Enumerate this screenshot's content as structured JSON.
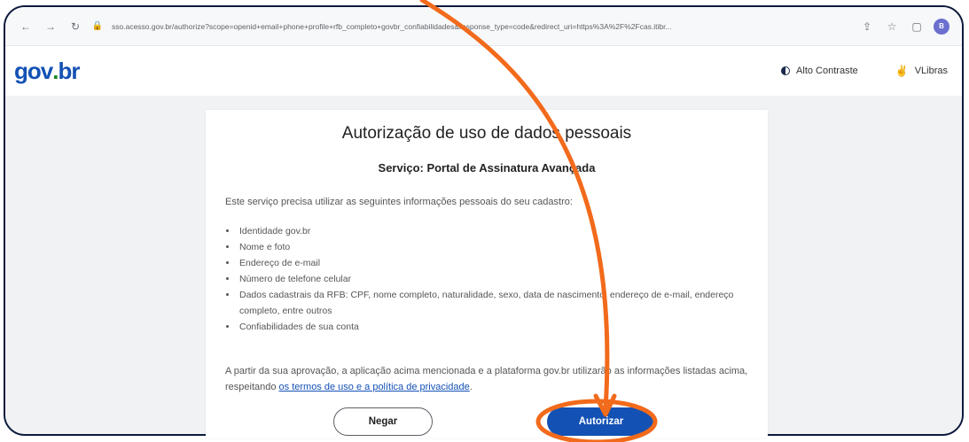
{
  "browser": {
    "url": "sso.acesso.gov.br/authorize?scope=openid+email+phone+profile+rfb_completo+govbr_confiabilidades&response_type=code&redirect_uri=https%3A%2F%2Fcas.itibr..."
  },
  "header": {
    "logo": {
      "gov": "gov",
      "dot": ".",
      "br": "br"
    },
    "contrast_label": "Alto Contraste",
    "vlibras_label": "VLibras"
  },
  "main": {
    "title": "Autorização de uso de dados pessoais",
    "service": "Serviço: Portal de Assinatura Avançada",
    "intro": "Este serviço precisa utilizar as seguintes informações pessoais do seu cadastro:",
    "items": [
      "Identidade gov.br",
      "Nome e foto",
      "Endereço de e-mail",
      "Número de telefone celular",
      "Dados cadastrais da RFB: CPF, nome completo, naturalidade, sexo, data de nascimento, endereço de e-mail, endereço completo, entre outros",
      "Confiabilidades de sua conta"
    ],
    "footer_text_1": "A partir da sua aprovação, a aplicação acima mencionada e a plataforma gov.br utilizarão as informações listadas acima, respeitando ",
    "terms_link": "os termos de uso e a política de privacidade",
    "footer_end": ".",
    "deny_button": "Negar",
    "authorize_button": "Autorizar"
  },
  "colors": {
    "primary": "#1351b4",
    "annotation": "#f26a1b",
    "frame": "#0c1a3d"
  },
  "annotation": {
    "icon": "orange-arrow-and-circle"
  }
}
